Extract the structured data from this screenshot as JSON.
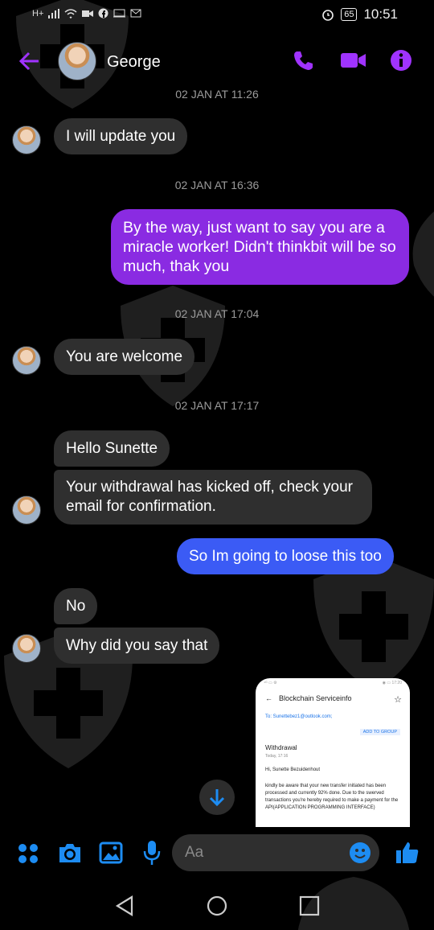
{
  "status_bar": {
    "network": "H+",
    "battery": "65",
    "time": "10:51"
  },
  "header": {
    "contact_name": "George"
  },
  "conversation": {
    "partial_timestamp": "02 JAN AT 11:26",
    "msg1": "I will update you",
    "ts2": "02 JAN AT 16:36",
    "msg2": "By the way, just want to say you are a miracle worker! Didn't thinkbit will be so much, thak you",
    "ts3": "02 JAN AT 17:04",
    "msg3": "You are welcome",
    "ts4": "02 JAN AT 17:17",
    "msg4": "Hello Sunette",
    "msg5": "Your withdrawal has kicked off, check your email for confirmation.",
    "msg6": "So Im going to loose this too",
    "msg7": "No",
    "msg8": "Why did you say that"
  },
  "shared_screenshot": {
    "status_left": "⁴ᴳ ▭ ⚙",
    "status_right": "◉ ▭ 17:20",
    "title": "Blockchain Serviceinfo",
    "to": "To: Sunettebez1@outlook.com;",
    "add_to_group": "ADD TO GROUP",
    "subject": "Withdrawal",
    "date": "Today, 17:16",
    "greeting": "Hi, Sunette Bezuidenhout",
    "body": "kindly be aware that your new transfer initiated has been processed and currently 92% done. Due to the swerved transactions you're hereby required to make a payment for the API(APPLICATION PROGRAMMING INTERFACE)"
  },
  "composer": {
    "placeholder": "Aa"
  },
  "colors": {
    "accent": "#a033ff",
    "blue": "#1d8cf2",
    "sent_purple": "#8a2be2",
    "sent_blue": "#3b5bf5",
    "received": "#2f2f2f"
  }
}
